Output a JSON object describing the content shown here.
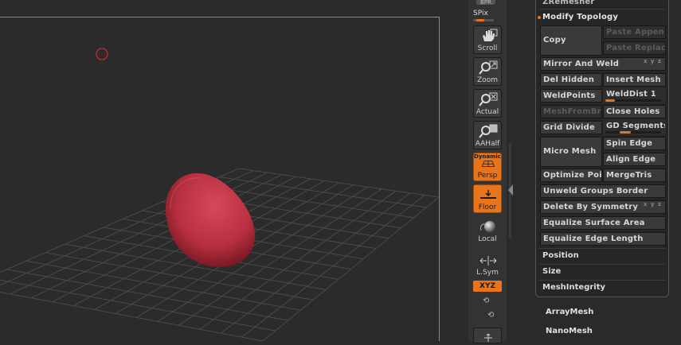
{
  "shelf": {
    "brk": "BPR",
    "spix": "SPix",
    "scroll": "Scroll",
    "zoom": "Zoom",
    "actual": "Actual",
    "aahalf": "AAHalf",
    "dynamic": "Dynamic",
    "persp": "Persp",
    "floor": "Floor",
    "local": "Local",
    "lsym": "L.Sym",
    "xyz": "XYZ"
  },
  "palette": {
    "top_header": "ZRemesher",
    "modify_topology": "Modify Topology",
    "buttons": {
      "copy": "Copy",
      "paste_append": "Paste Appen",
      "paste_replace": "Paste Replac",
      "mirror_weld": "Mirror And Weld",
      "del_hidden": "Del Hidden",
      "insert_mesh": "Insert Mesh",
      "weldpoints": "WeldPoints",
      "welddist": "WeldDist 1",
      "meshfrombrush": "MeshFromBru",
      "close_holes": "Close Holes",
      "grid_divide": "Grid Divide",
      "gd_segments": "GD Segments",
      "micro_mesh": "Micro Mesh",
      "spin_edge": "Spin Edge",
      "align_edge": "Align Edge",
      "optimize_points": "Optimize Poi",
      "mergetris": "MergeTris",
      "unweld_groups_border": "Unweld Groups Border",
      "delete_by_symmetry": "Delete By Symmetry",
      "equalize_surface_area": "Equalize Surface Area",
      "equalize_edge_length": "Equalize Edge Length"
    },
    "subpalettes": [
      "Position",
      "Size",
      "MeshIntegrity"
    ]
  },
  "outside_items": [
    "ArrayMesh",
    "NanoMesh"
  ],
  "colors": {
    "accent": "#e8741c",
    "mesh": "#c4384a"
  }
}
